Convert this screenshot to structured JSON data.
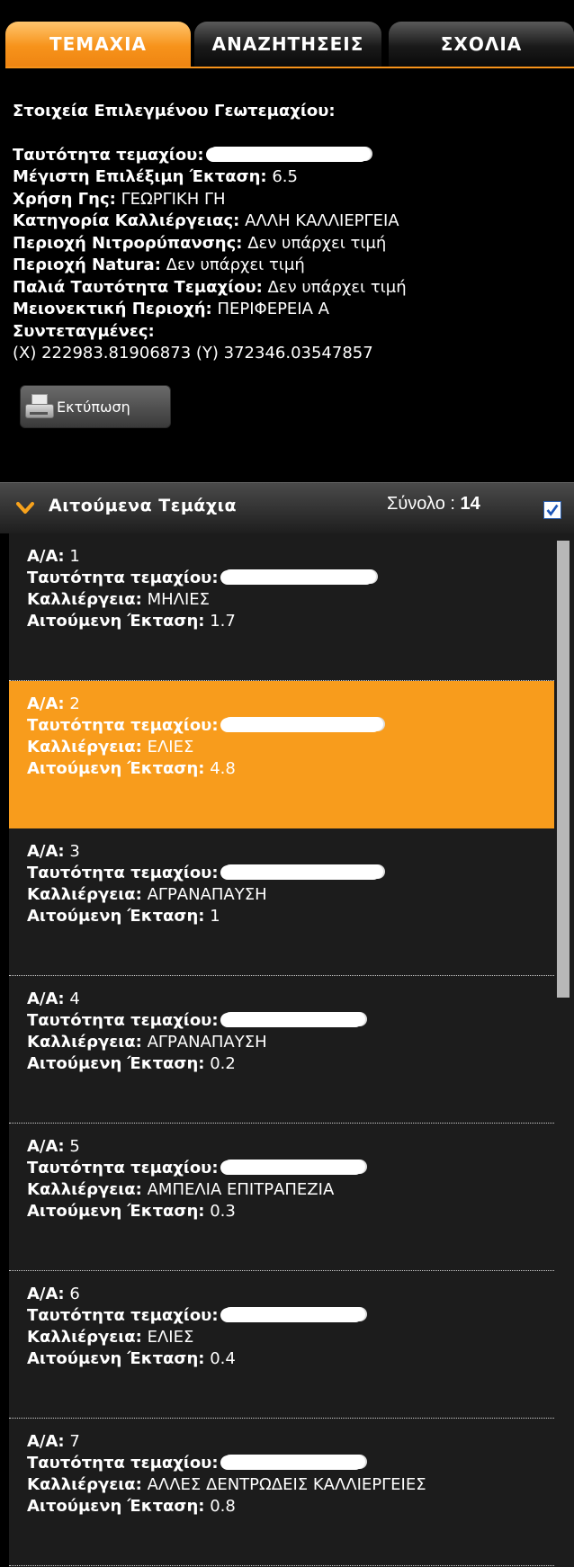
{
  "tabs": [
    {
      "label": "ΤΕΜΑΧΙΑ",
      "active": true
    },
    {
      "label": "ΑΝΑΖΗΤΗΣΕΙΣ",
      "active": false
    },
    {
      "label": "ΣΧΟΛΙΑ",
      "active": false
    }
  ],
  "details": {
    "heading": "Στοιχεία Επιλεγμένου Γεωτεμαχίου:",
    "parcel_id_label": "Ταυτότητα τεμαχίου:",
    "max_area_label": "Μέγιστη Επιλέξιμη Έκταση:",
    "max_area_value": "6.5",
    "land_use_label": "Χρήση Γης:",
    "land_use_value": "ΓΕΩΡΓΙΚΗ ΓΗ",
    "crop_category_label": "Κατηγορία Καλλιέργειας:",
    "crop_category_value": "ΑΛΛΗ ΚΑΛΛΙΕΡΓΕΙΑ",
    "nitrate_label": "Περιοχή Νιτρορύπανσης:",
    "nitrate_value": "Δεν υπάρχει τιμή",
    "natura_label": "Περιοχή Natura:",
    "natura_value": "Δεν υπάρχει τιμή",
    "old_id_label": "Παλιά Ταυτότητα Τεμαχίου:",
    "old_id_value": "Δεν υπάρχει τιμή",
    "disadvantaged_label": "Μειονεκτική Περιοχή:",
    "disadvantaged_value": "ΠΕΡΙΦΕΡΕΙΑ Α",
    "coords_label": "Συντεταγμένες:",
    "coords_value": "(X) 222983.81906873 (Y) 372346.03547857",
    "print_label": "Εκτύπωση"
  },
  "section": {
    "title": "Αιτούμενα Τεμάχια",
    "total_label": "Σύνολο :",
    "total_value": "14",
    "checkbox_checked": true
  },
  "items": [
    {
      "aa_label": "Α/Α:",
      "aa": "1",
      "id_label": "Ταυτότητα τεμαχίου:",
      "crop_label": "Καλλιέργεια:",
      "crop": "ΜΗΛΙΕΣ",
      "area_label": "Αιτούμενη Έκταση:",
      "area": "1.7",
      "selected": false
    },
    {
      "aa_label": "Α/Α:",
      "aa": "2",
      "id_label": "Ταυτότητα τεμαχίου:",
      "crop_label": "Καλλιέργεια:",
      "crop": "ΕΛΙΕΣ",
      "area_label": "Αιτούμενη Έκταση:",
      "area": "4.8",
      "selected": true
    },
    {
      "aa_label": "Α/Α:",
      "aa": "3",
      "id_label": "Ταυτότητα τεμαχίου:",
      "crop_label": "Καλλιέργεια:",
      "crop": "ΑΓΡΑΝΑΠΑΥΣΗ",
      "area_label": "Αιτούμενη Έκταση:",
      "area": "1",
      "selected": false
    },
    {
      "aa_label": "Α/Α:",
      "aa": "4",
      "id_label": "Ταυτότητα τεμαχίου:",
      "crop_label": "Καλλιέργεια:",
      "crop": "ΑΓΡΑΝΑΠΑΥΣΗ",
      "area_label": "Αιτούμενη Έκταση:",
      "area": "0.2",
      "selected": false
    },
    {
      "aa_label": "Α/Α:",
      "aa": "5",
      "id_label": "Ταυτότητα τεμαχίου:",
      "crop_label": "Καλλιέργεια:",
      "crop": "ΑΜΠΕΛΙΑ ΕΠΙΤΡΑΠΕΖΙΑ",
      "area_label": "Αιτούμενη Έκταση:",
      "area": "0.3",
      "selected": false
    },
    {
      "aa_label": "Α/Α:",
      "aa": "6",
      "id_label": "Ταυτότητα τεμαχίου:",
      "crop_label": "Καλλιέργεια:",
      "crop": "ΕΛΙΕΣ",
      "area_label": "Αιτούμενη Έκταση:",
      "area": "0.4",
      "selected": false
    },
    {
      "aa_label": "Α/Α:",
      "aa": "7",
      "id_label": "Ταυτότητα τεμαχίου:",
      "crop_label": "Καλλιέργεια:",
      "crop": "ΑΛΛΕΣ ΔΕΝΤΡΩΔΕΙΣ ΚΑΛΛΙΕΡΓΕΙΕΣ",
      "area_label": "Αιτούμενη Έκταση:",
      "area": "0.8",
      "selected": false
    }
  ],
  "colors": {
    "accent": "#f89c1c",
    "panel_bg": "#000000",
    "list_bg": "#1c1c1c"
  }
}
